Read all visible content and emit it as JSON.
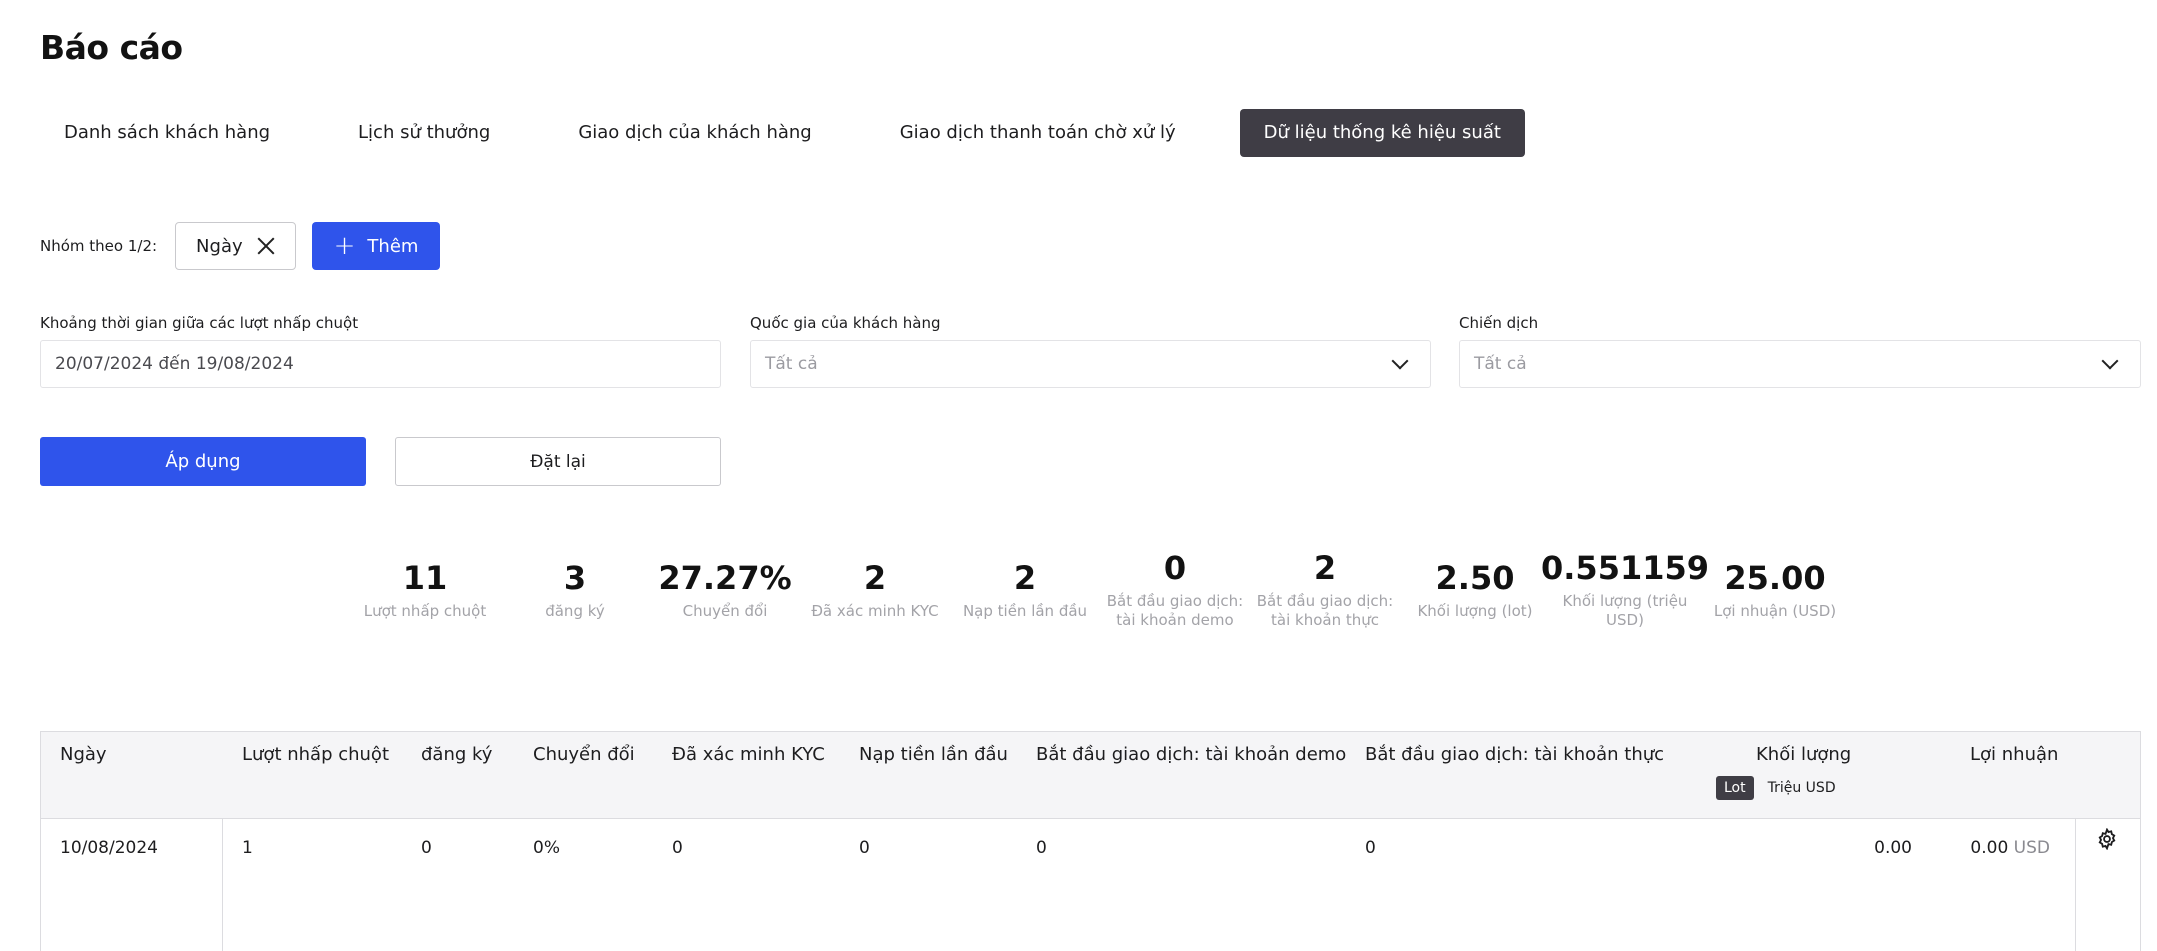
{
  "page": {
    "title": "Báo cáo"
  },
  "tabs": [
    {
      "label": "Danh sách khách hàng",
      "active": false
    },
    {
      "label": "Lịch sử thưởng",
      "active": false
    },
    {
      "label": "Giao dịch của khách hàng",
      "active": false
    },
    {
      "label": "Giao dịch thanh toán chờ xử lý",
      "active": false
    },
    {
      "label": "Dữ liệu thống kê hiệu suất",
      "active": true
    }
  ],
  "group": {
    "label": "Nhóm theo 1/2:",
    "chip": "Ngày",
    "add_label": "Thêm"
  },
  "filters": {
    "period": {
      "label": "Khoảng thời gian giữa các lượt nhấp chuột",
      "value": "20/07/2024 đến 19/08/2024"
    },
    "country": {
      "label": "Quốc gia của khách hàng",
      "placeholder": "Tất cả"
    },
    "campaign": {
      "label": "Chiến dịch",
      "placeholder": "Tất cả"
    }
  },
  "actions": {
    "apply": "Áp dụng",
    "reset": "Đặt lại"
  },
  "stats": [
    {
      "value": "11",
      "label": "Lượt nhấp chuột"
    },
    {
      "value": "3",
      "label": "đăng ký"
    },
    {
      "value": "27.27%",
      "label": "Chuyển đổi"
    },
    {
      "value": "2",
      "label": "Đã xác minh KYC"
    },
    {
      "value": "2",
      "label": "Nạp tiền lần đầu"
    },
    {
      "value": "0",
      "label": "Bắt đầu giao dịch: tài khoản demo"
    },
    {
      "value": "2",
      "label": "Bắt đầu giao dịch: tài khoản thực"
    },
    {
      "value": "2.50",
      "label": "Khối lượng (lot)"
    },
    {
      "value": "0.551159",
      "label": "Khối lượng (triệu USD)"
    },
    {
      "value": "25.00",
      "label": "Lợi nhuận (USD)"
    }
  ],
  "table": {
    "headers": {
      "date": "Ngày",
      "clicks": "Lượt nhấp chuột",
      "signups": "đăng ký",
      "conversion": "Chuyển đổi",
      "kyc": "Đã xác minh KYC",
      "first_deposit": "Nạp tiền lần đầu",
      "demo": "Bắt đầu giao dịch: tài khoản demo",
      "real": "Bắt đầu giao dịch: tài khoản thực",
      "volume": "Khối lượng",
      "profit": "Lợi nhuận"
    },
    "volume_units": {
      "lot": "Lot",
      "usd": "Triệu USD"
    },
    "rows": [
      {
        "date": "10/08/2024",
        "clicks": "1",
        "signups": "0",
        "conversion": "0%",
        "kyc": "0",
        "first_deposit": "0",
        "demo": "0",
        "real": "0",
        "volume": "0.00",
        "profit": "0.00",
        "profit_unit": "USD"
      }
    ]
  },
  "colors": {
    "primary": "#2f54eb",
    "active_tab": "#3f3d45"
  }
}
